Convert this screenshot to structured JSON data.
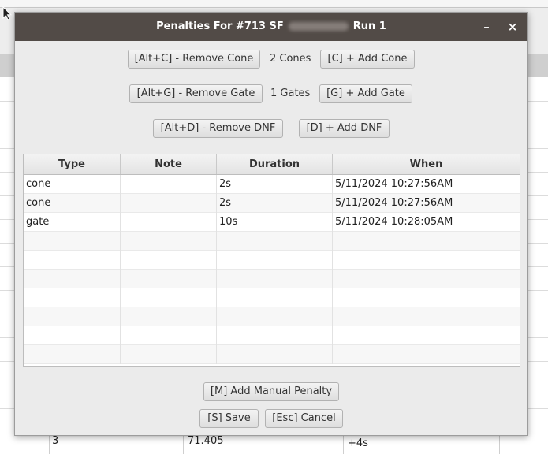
{
  "dialog": {
    "title_prefix": "Penalties For #713 SF",
    "title_suffix": "Run  1",
    "minimize_label": "–",
    "close_label": "×"
  },
  "cone": {
    "remove_label": "[Alt+C] - Remove Cone",
    "count_text": "2 Cones",
    "add_label": "[C] + Add Cone"
  },
  "gate": {
    "remove_label": "[Alt+G] - Remove Gate",
    "count_text": "1 Gates",
    "add_label": "[G] + Add Gate"
  },
  "dnf": {
    "remove_label": "[Alt+D] - Remove DNF",
    "add_label": "[D] + Add DNF"
  },
  "table": {
    "columns": [
      "Type",
      "Note",
      "Duration",
      "When"
    ],
    "rows": [
      {
        "type": "cone",
        "note": "",
        "duration": "2s",
        "when": "5/11/2024 10:27:56AM"
      },
      {
        "type": "cone",
        "note": "",
        "duration": "2s",
        "when": "5/11/2024 10:27:56AM"
      },
      {
        "type": "gate",
        "note": "",
        "duration": "10s",
        "when": "5/11/2024 10:28:05AM"
      }
    ]
  },
  "footer": {
    "manual_label": "[M] Add Manual Penalty",
    "save_label": "[S] Save",
    "cancel_label": "[Esc] Cancel"
  },
  "background": {
    "cells": [
      "3",
      "71.405",
      "+4s"
    ]
  }
}
